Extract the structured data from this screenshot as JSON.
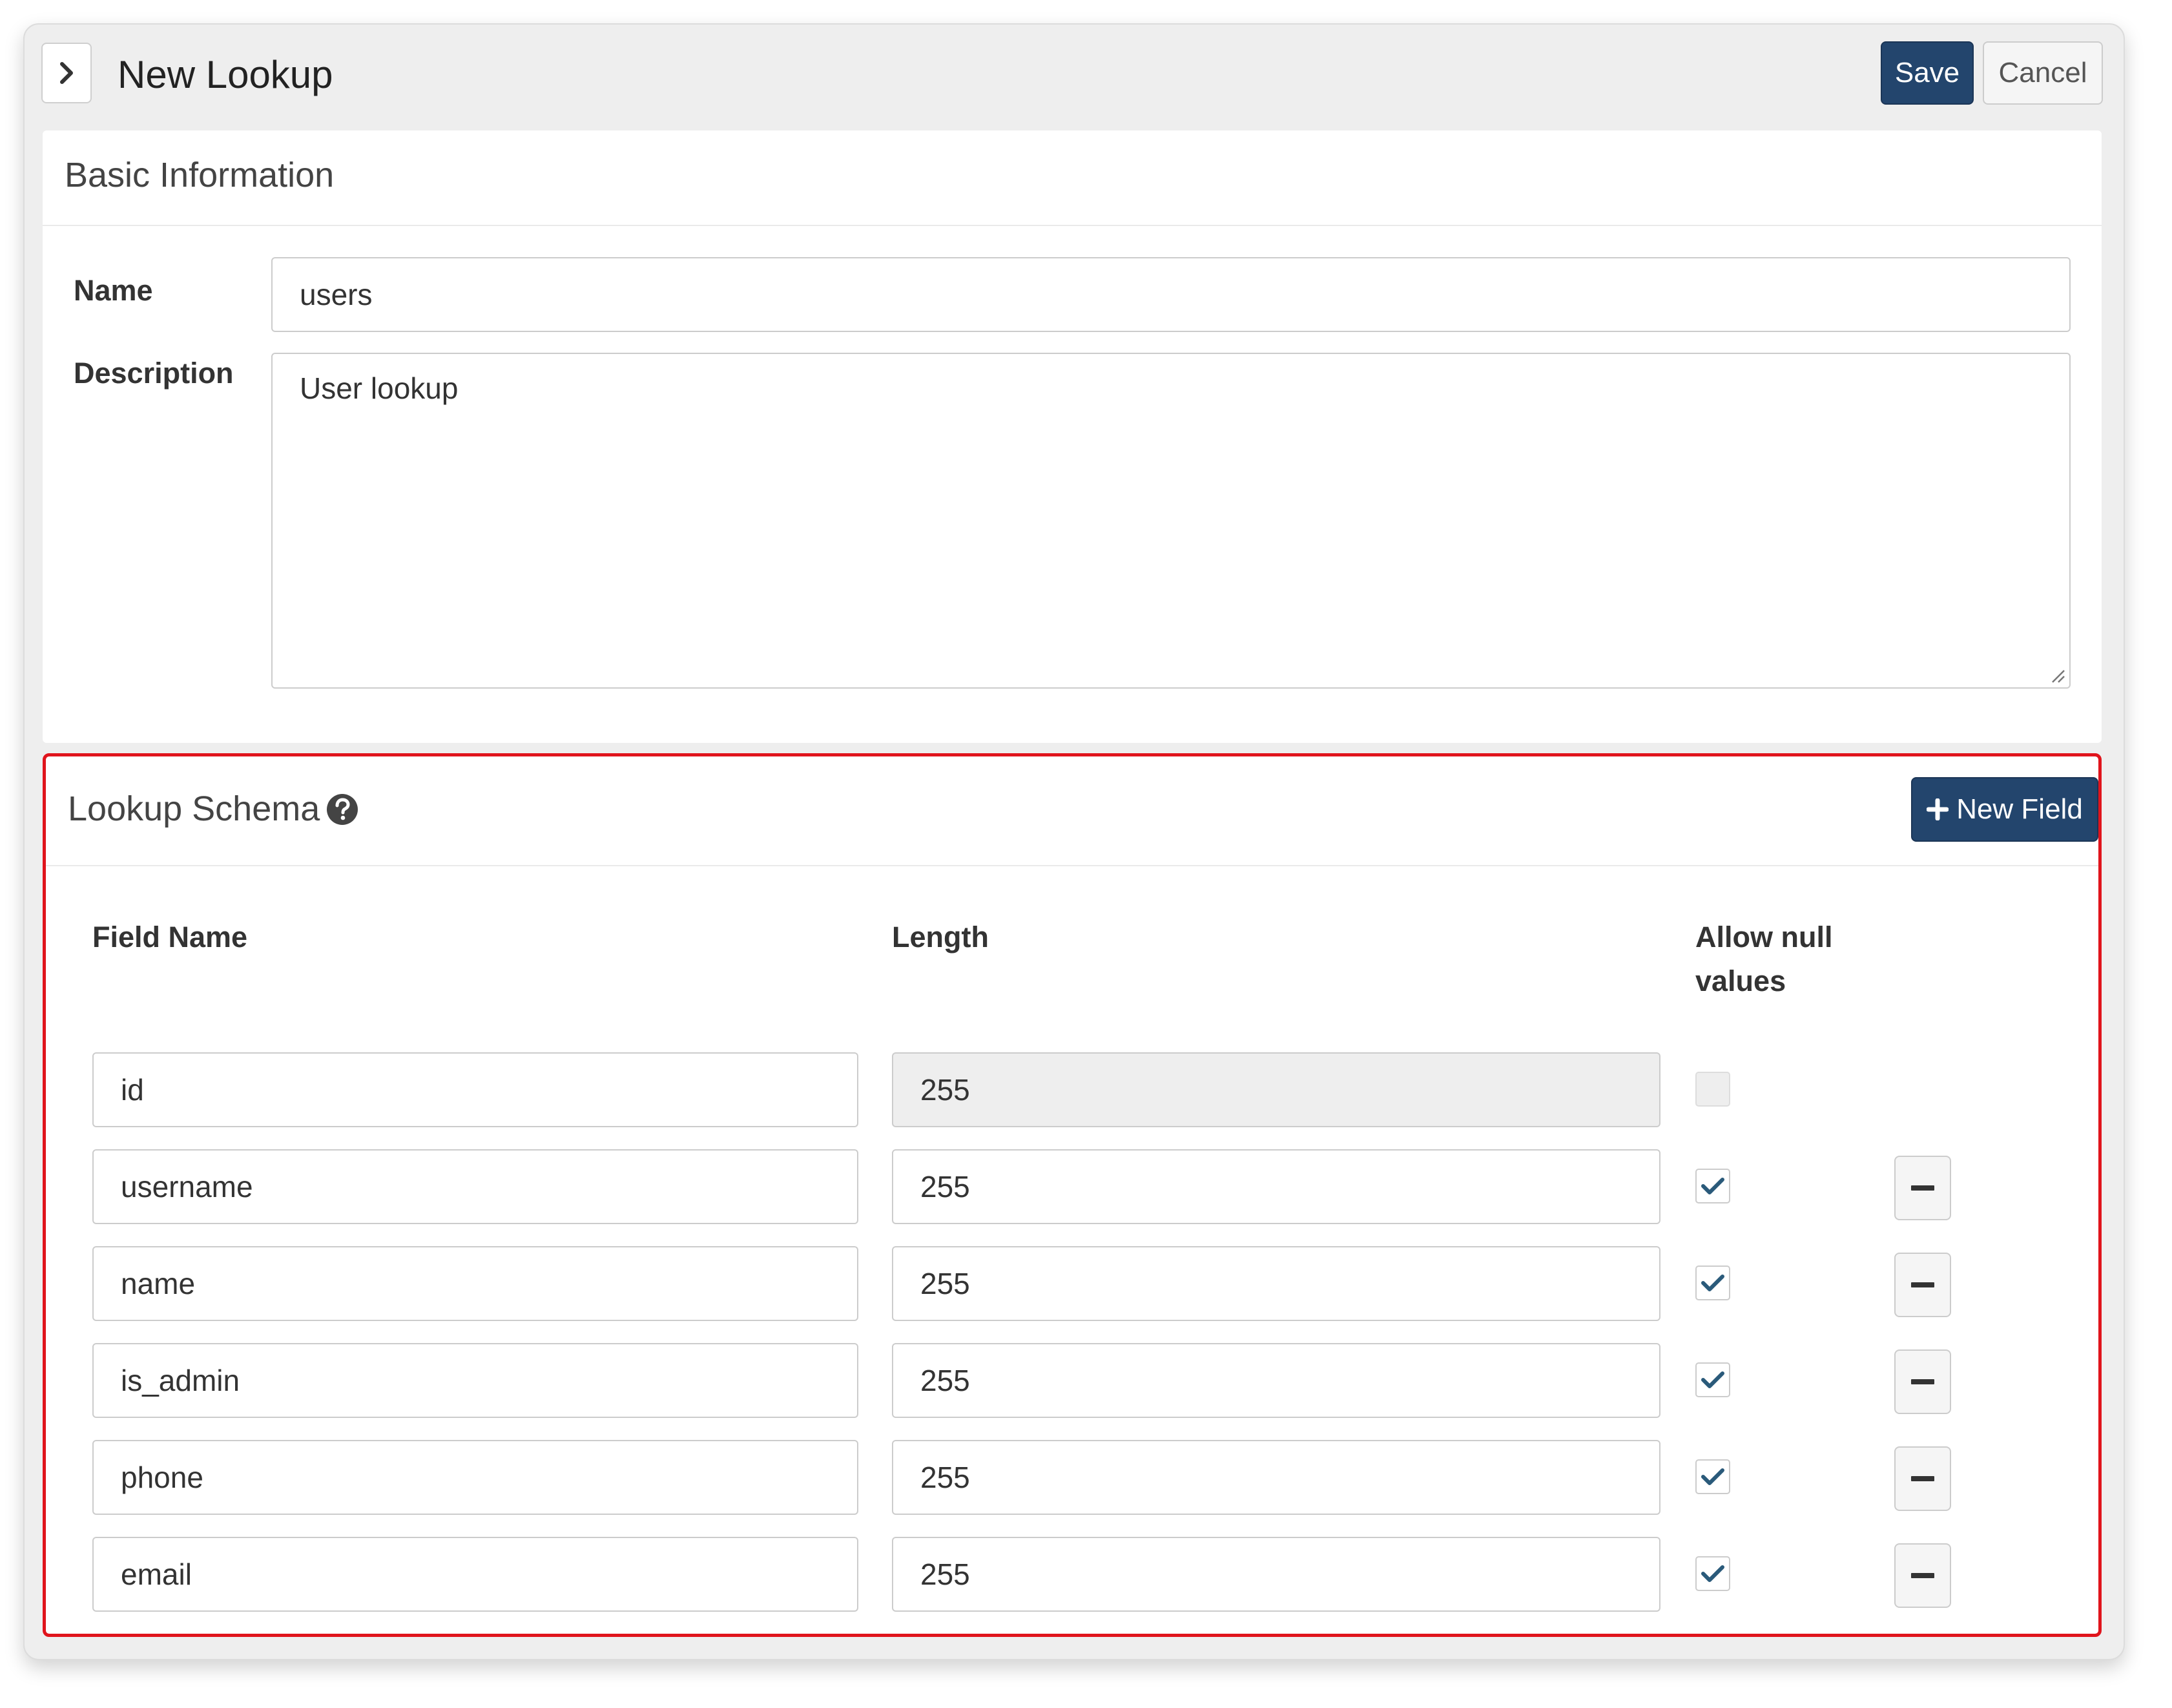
{
  "header": {
    "title": "New Lookup",
    "save_label": "Save",
    "cancel_label": "Cancel"
  },
  "basic": {
    "title": "Basic Information",
    "name_label": "Name",
    "name_value": "users",
    "description_label": "Description",
    "description_value": "User lookup"
  },
  "schema": {
    "title": "Lookup Schema",
    "new_field_label": "New Field",
    "columns": {
      "field_name": "Field Name",
      "length": "Length",
      "allow_null_line1": "Allow null",
      "allow_null_line2": "values"
    },
    "rows": [
      {
        "field": "id",
        "length": "255",
        "allow_null": false,
        "locked": true
      },
      {
        "field": "username",
        "length": "255",
        "allow_null": true,
        "locked": false
      },
      {
        "field": "name",
        "length": "255",
        "allow_null": true,
        "locked": false
      },
      {
        "field": "is_admin",
        "length": "255",
        "allow_null": true,
        "locked": false
      },
      {
        "field": "phone",
        "length": "255",
        "allow_null": true,
        "locked": false
      },
      {
        "field": "email",
        "length": "255",
        "allow_null": true,
        "locked": false
      }
    ]
  },
  "icons": {
    "expand": "chevron-right-icon",
    "help": "question-circle-icon",
    "add": "plus-icon",
    "remove": "minus-icon",
    "check": "check-icon"
  },
  "colors": {
    "primary": "#23456d",
    "highlight_border": "#e0141c",
    "check": "#2a5a7a"
  }
}
